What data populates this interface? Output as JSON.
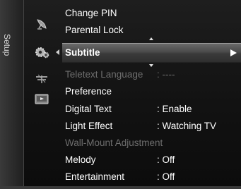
{
  "side_tab": {
    "label": "Setup"
  },
  "icons": [
    {
      "name": "satellite-dish-icon"
    },
    {
      "name": "gear-icon"
    },
    {
      "name": "antenna-icon"
    },
    {
      "name": "input-icon"
    }
  ],
  "menu": {
    "items": [
      {
        "label": "Change PIN",
        "value": "",
        "enabled": true,
        "selected": false
      },
      {
        "label": "Parental Lock",
        "value": "",
        "enabled": true,
        "selected": false
      },
      {
        "label": "Subtitle",
        "value": "",
        "enabled": true,
        "selected": true
      },
      {
        "label": "Teletext Language",
        "value": ": ----",
        "enabled": false,
        "selected": false
      },
      {
        "label": "Preference",
        "value": "",
        "enabled": true,
        "selected": false
      },
      {
        "label": "Digital Text",
        "value": ": Enable",
        "enabled": true,
        "selected": false
      },
      {
        "label": "Light Effect",
        "value": ": Watching TV",
        "enabled": true,
        "selected": false
      },
      {
        "label": "Wall-Mount Adjustment",
        "value": "",
        "enabled": false,
        "selected": false
      },
      {
        "label": "Melody",
        "value": ": Off",
        "enabled": true,
        "selected": false
      },
      {
        "label": "Entertainment",
        "value": ": Off",
        "enabled": true,
        "selected": false
      }
    ]
  },
  "colors": {
    "background": "#141414",
    "text": "#ffffff",
    "disabled_text": "#6e6e6e",
    "highlight": "#4a4a4a"
  }
}
